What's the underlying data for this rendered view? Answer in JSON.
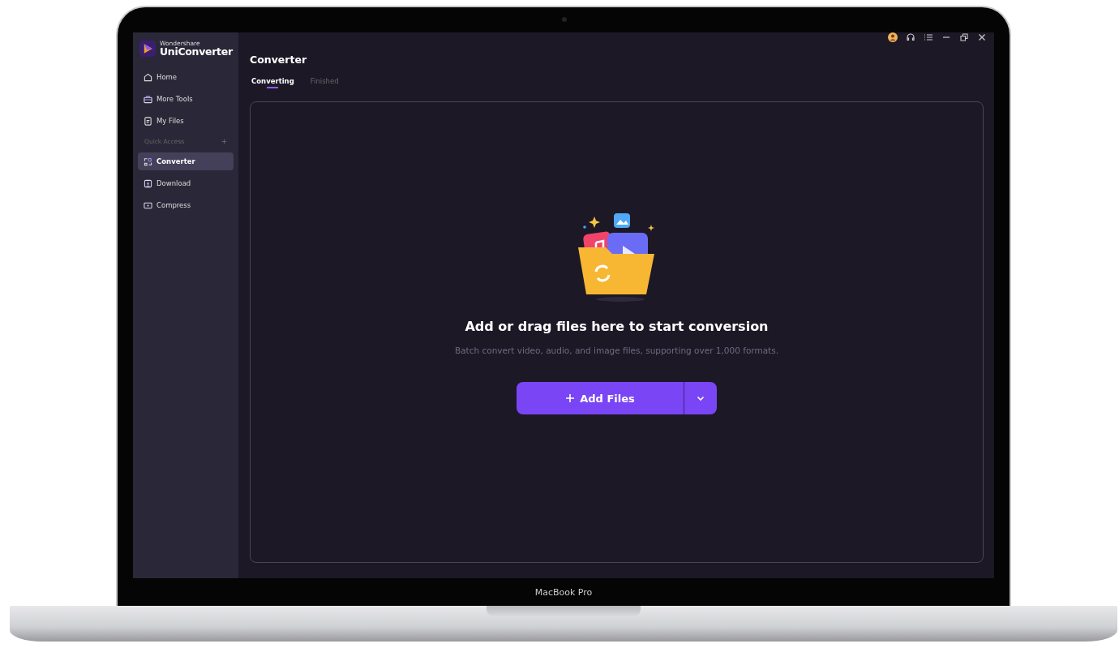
{
  "device": {
    "label": "MacBook Pro"
  },
  "sidebar": {
    "brand": {
      "company": "Wondershare",
      "product": "UniConverter"
    },
    "items": [
      {
        "label": "Home",
        "selected": false
      },
      {
        "label": "More Tools",
        "selected": false
      },
      {
        "label": "My Files",
        "selected": false
      }
    ],
    "section": {
      "title": "Quick Access"
    },
    "quick_items": [
      {
        "label": "Converter",
        "selected": true
      },
      {
        "label": "Download",
        "selected": false
      },
      {
        "label": "Compress",
        "selected": false
      }
    ]
  },
  "main": {
    "title": "Converter",
    "tabs": [
      {
        "label": "Converting",
        "selected": true
      },
      {
        "label": "Finished",
        "selected": false
      }
    ],
    "dropzone": {
      "heading": "Add or drag files here to start conversion",
      "subtext": "Batch convert video, audio, and image files, supporting over 1,000 formats.",
      "button": "Add Files"
    }
  }
}
